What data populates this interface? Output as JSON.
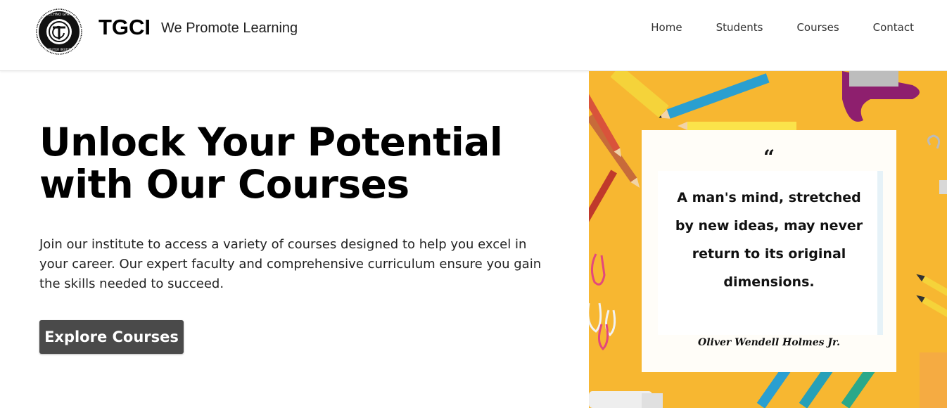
{
  "header": {
    "brand_name": "TGCI",
    "tagline": "We Promote Learning",
    "logo_icon": "tgci-logo-icon",
    "nav": [
      {
        "label": "Home"
      },
      {
        "label": "Students"
      },
      {
        "label": "Courses"
      },
      {
        "label": "Contact"
      }
    ]
  },
  "hero": {
    "title": "Unlock Your Potential with Our Courses",
    "description": "Join our institute to access a variety of courses designed to help you excel in your career. Our expert faculty and comprehensive curriculum ensure you gain the skills needed to succeed.",
    "cta_label": "Explore Courses"
  },
  "quote": {
    "mark": "“",
    "text": "A man's mind, stretched by new ideas, may never return to its original dimensions.",
    "author": "Oliver Wendell Holmes Jr."
  },
  "colors": {
    "cta_bg": "#4a4a4a",
    "image_bg": "#f7b731"
  }
}
